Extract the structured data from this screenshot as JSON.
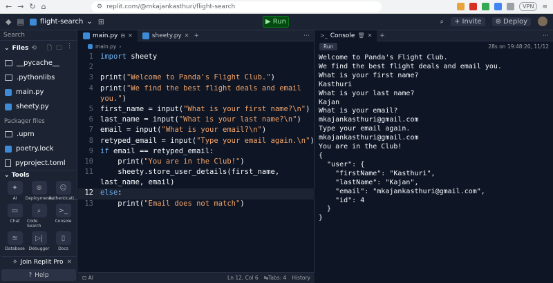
{
  "browser": {
    "url": "replit.com/@mkajankasthuri/flight-search",
    "vpn": "VPN"
  },
  "topbar": {
    "project": "flight-search",
    "run_label": "Run",
    "invite_label": "Invite",
    "deploy_label": "Deploy"
  },
  "sidebar": {
    "search_placeholder": "Search",
    "files_label": "Files",
    "files": [
      {
        "name": "__pycache__",
        "kind": "folder"
      },
      {
        "name": ".pythonlibs",
        "kind": "folder"
      },
      {
        "name": "main.py",
        "kind": "python"
      },
      {
        "name": "sheety.py",
        "kind": "python"
      }
    ],
    "packager_label": "Packager files",
    "packager_files": [
      {
        "name": ".upm",
        "kind": "folder"
      },
      {
        "name": "poetry.lock",
        "kind": "python"
      },
      {
        "name": "pyproject.toml",
        "kind": "doc"
      }
    ],
    "tools_label": "Tools",
    "tools": [
      "AI",
      "Deployments",
      "Authenticati...",
      "Chat",
      "Code Search",
      "Console",
      "Database",
      "Debugger",
      "Docs"
    ],
    "join_pro": "Join Replit Pro",
    "help": "Help"
  },
  "editor": {
    "tabs": [
      "main.py",
      "sheety.py"
    ],
    "breadcrumb": "main.py",
    "status_ai": "AI",
    "status_pos": "Ln 12, Col 6",
    "status_tabs": "Tabs: 4",
    "status_history": "History",
    "lines": [
      "1",
      "2",
      "3",
      "4",
      "5",
      "6",
      "7",
      "8",
      "9",
      "10",
      "11",
      "12",
      "13"
    ],
    "code": {
      "l1_kw": "import",
      "l1_rest": " sheety",
      "l3_a": "print(",
      "l3_s": "\"Welcome to Panda's Flight Club.\"",
      "l3_b": ")",
      "l4_a": "print(",
      "l4_s": "\"We find the best flight deals and email",
      "l4_s2": "you.\"",
      "l4_b": ")",
      "l5_a": "first_name = input(",
      "l5_s": "\"What is your first name?\\n\"",
      "l5_b": ")",
      "l6_a": "last_name = input(",
      "l6_s": "\"What is your last name?\\n\"",
      "l6_b": ")",
      "l7_a": "email = input(",
      "l7_s": "\"What is your email?\\n\"",
      "l7_b": ")",
      "l8_a": "retyped_email = input(",
      "l8_s": "\"Type your email again.\\n\"",
      "l8_b": ")",
      "l9_kw": "if",
      "l9_rest": " email == retyped_email:",
      "l10_a": "print(",
      "l10_s": "\"You are in the Club!\"",
      "l10_b": ")",
      "l11_a": "sheety.store_user_details(first_name,",
      "l11_b": "last_name, email)",
      "l12_kw": "else",
      "l12_rest": ":",
      "l13_a": "print(",
      "l13_s": "\"Email does not match\"",
      "l13_b": ")"
    }
  },
  "console": {
    "tab": "Console",
    "run_label": "Run",
    "status": "28s on 19:48:20, 11/12",
    "output": "Welcome to Panda's Flight Club.\nWe find the best flight deals and email you.\nWhat is your first name?\nKasthuri\nWhat is your last name?\nKajan\nWhat is your email?\nmkajankasthuri@gmail.com\nType your email again.\nmkajankasthuri@gmail.com\nYou are in the Club!\n{\n  \"user\": {\n    \"firstName\": \"Kasthuri\",\n    \"lastName\": \"Kajan\",\n    \"email\": \"mkajankasthuri@gmail.com\",\n    \"id\": 4\n  }\n}"
  }
}
